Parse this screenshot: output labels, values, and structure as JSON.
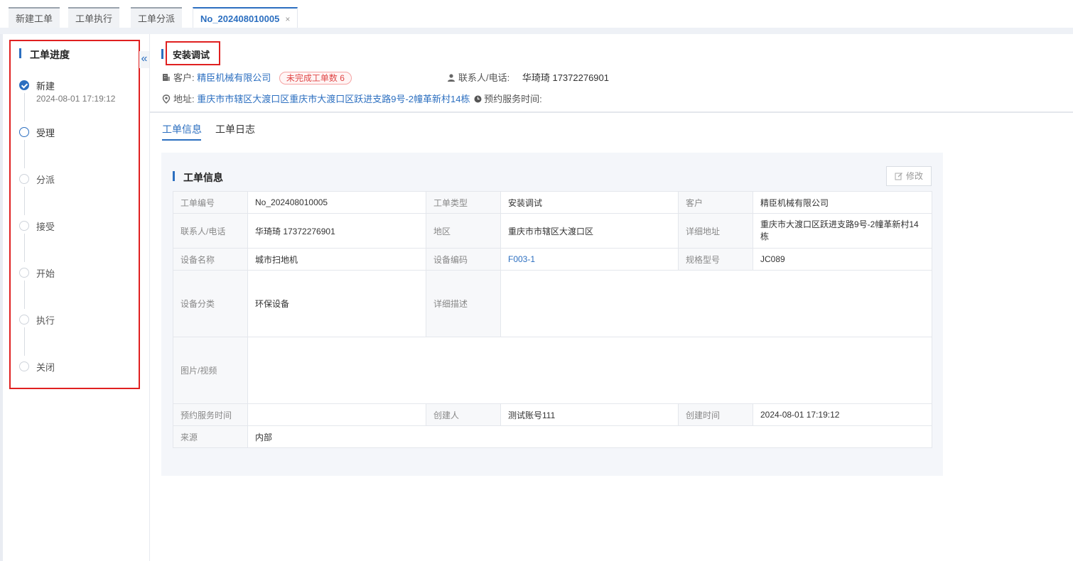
{
  "tabs": [
    {
      "label": "新建工单"
    },
    {
      "label": "工单执行"
    },
    {
      "label": "工单分派"
    },
    {
      "label": "No_202408010005",
      "close": "×"
    }
  ],
  "progress": {
    "title": "工单进度",
    "steps": [
      {
        "label": "新建",
        "time": "2024-08-01 17:19:12"
      },
      {
        "label": "受理"
      },
      {
        "label": "分派"
      },
      {
        "label": "接受"
      },
      {
        "label": "开始"
      },
      {
        "label": "执行"
      },
      {
        "label": "关闭"
      }
    ]
  },
  "collapse_icon": "«",
  "header": {
    "title": "安装调试",
    "customer_label": "客户:",
    "customer_value": "精臣机械有限公司",
    "unfinished_badge": "未完成工单数 6",
    "contact_label": "联系人/电话:",
    "contact_value": "华琦琦 17372276901",
    "address_label": "地址:",
    "address_value": "重庆市市辖区大渡口区重庆市大渡口区跃进支路9号-2幢革新村14栋",
    "appointment_label": "预约服务时间:"
  },
  "subtabs": [
    "工单信息",
    "工单日志"
  ],
  "card": {
    "title": "工单信息",
    "edit_label": "修改",
    "rows": {
      "r1": {
        "k1": "工单编号",
        "v1": "No_202408010005",
        "k2": "工单类型",
        "v2": "安装调试",
        "k3": "客户",
        "v3": "精臣机械有限公司"
      },
      "r2": {
        "k1": "联系人/电话",
        "v1": "华琦琦 17372276901",
        "k2": "地区",
        "v2": "重庆市市辖区大渡口区",
        "k3": "详细地址",
        "v3": "重庆市大渡口区跃进支路9号-2幢革新村14栋"
      },
      "r3": {
        "k1": "设备名称",
        "v1": "城市扫地机",
        "k2": "设备编码",
        "v2": "F003-1",
        "k3": "规格型号",
        "v3": "JC089"
      },
      "r4": {
        "k1": "设备分类",
        "v1": "环保设备",
        "k2": "详细描述",
        "v2": ""
      },
      "r5": {
        "k1": "图片/视频",
        "v1": ""
      },
      "r6": {
        "k1": "预约服务时间",
        "v1": "",
        "k2": "创建人",
        "v2": "测试账号111",
        "k3": "创建时间",
        "v3": "2024-08-01 17:19:12"
      },
      "r7": {
        "k1": "来源",
        "v1": "内部"
      }
    }
  },
  "colors": {
    "accent": "#2c6fc0",
    "highlight_border": "#e02020",
    "badge_text": "#e04848"
  }
}
